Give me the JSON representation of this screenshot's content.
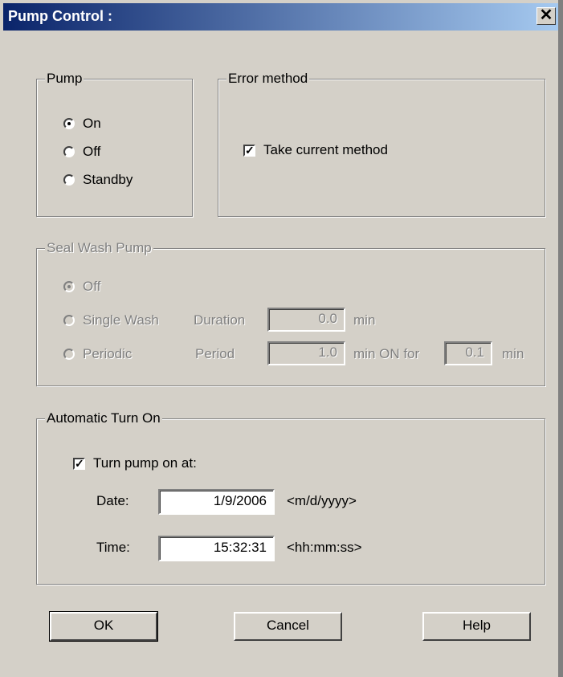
{
  "window": {
    "title": "Pump Control :",
    "close_glyph": "✕"
  },
  "pump": {
    "legend": "Pump",
    "options": [
      {
        "label": "On",
        "selected": true
      },
      {
        "label": "Off",
        "selected": false
      },
      {
        "label": "Standby",
        "selected": false
      }
    ]
  },
  "error_method": {
    "legend": "Error method",
    "take_current_label": "Take current method",
    "take_current_checked": true
  },
  "seal_wash": {
    "legend": "Seal Wash Pump",
    "off_label": "Off",
    "single_label": "Single Wash",
    "duration_label": "Duration",
    "duration_value": "0.0",
    "duration_unit": "min",
    "periodic_label": "Periodic",
    "period_label": "Period",
    "period_value": "1.0",
    "on_for_label": "min ON for",
    "on_for_value": "0.1",
    "on_for_unit": "min"
  },
  "auto_on": {
    "legend": "Automatic Turn On",
    "turn_on_label": "Turn pump on at:",
    "turn_on_checked": true,
    "date_label": "Date:",
    "date_value": "1/9/2006",
    "date_format": "<m/d/yyyy>",
    "time_label": "Time:",
    "time_value": "15:32:31",
    "time_format": "<hh:mm:ss>"
  },
  "buttons": {
    "ok": "OK",
    "cancel": "Cancel",
    "help": "Help"
  }
}
